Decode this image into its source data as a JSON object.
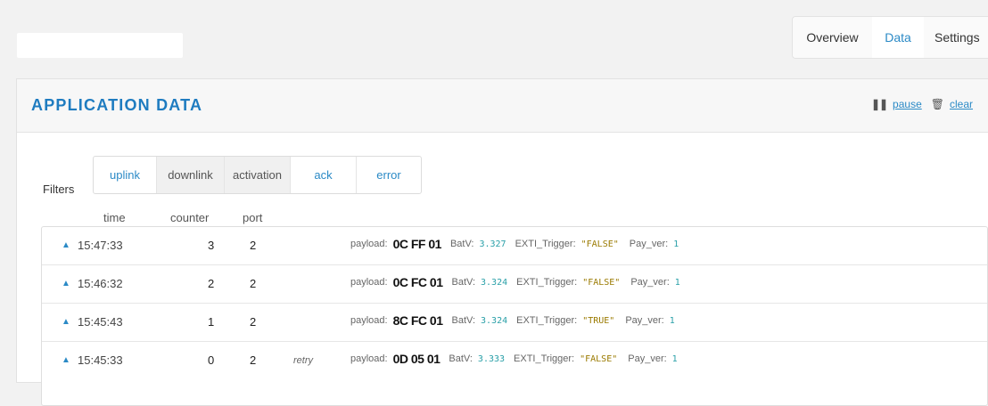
{
  "nav": {
    "tabs": [
      {
        "label": "Overview",
        "active": false
      },
      {
        "label": "Data",
        "active": true
      },
      {
        "label": "Settings",
        "active": false
      }
    ]
  },
  "panel": {
    "title": "APPLICATION DATA",
    "pause_label": "pause",
    "clear_label": "clear"
  },
  "filters": {
    "label": "Filters",
    "items": [
      {
        "label": "uplink",
        "selected": true
      },
      {
        "label": "downlink",
        "selected": false
      },
      {
        "label": "activation",
        "selected": false
      },
      {
        "label": "ack",
        "selected": true
      },
      {
        "label": "error",
        "selected": true
      }
    ]
  },
  "columns": {
    "time": "time",
    "counter": "counter",
    "port": "port"
  },
  "rows": [
    {
      "time": "15:47:33",
      "counter": "3",
      "port": "2",
      "retry": "",
      "payload_label": "payload:",
      "payload": "0C FF 01",
      "batv_label": "BatV:",
      "batv": "3.327",
      "exti_label": "EXTI_Trigger:",
      "exti": "\"FALSE\"",
      "payver_label": "Pay_ver:",
      "payver": "1"
    },
    {
      "time": "15:46:32",
      "counter": "2",
      "port": "2",
      "retry": "",
      "payload_label": "payload:",
      "payload": "0C FC 01",
      "batv_label": "BatV:",
      "batv": "3.324",
      "exti_label": "EXTI_Trigger:",
      "exti": "\"FALSE\"",
      "payver_label": "Pay_ver:",
      "payver": "1"
    },
    {
      "time": "15:45:43",
      "counter": "1",
      "port": "2",
      "retry": "",
      "payload_label": "payload:",
      "payload": "8C FC 01",
      "batv_label": "BatV:",
      "batv": "3.324",
      "exti_label": "EXTI_Trigger:",
      "exti": "\"TRUE\"",
      "payver_label": "Pay_ver:",
      "payver": "1"
    },
    {
      "time": "15:45:33",
      "counter": "0",
      "port": "2",
      "retry": "retry",
      "payload_label": "payload:",
      "payload": "0D 05 01",
      "batv_label": "BatV:",
      "batv": "3.333",
      "exti_label": "EXTI_Trigger:",
      "exti": "\"FALSE\"",
      "payver_label": "Pay_ver:",
      "payver": "1"
    }
  ],
  "colors": {
    "accent": "#2b8ac6",
    "number": "#2aa0a8",
    "string": "#9a7a00"
  }
}
